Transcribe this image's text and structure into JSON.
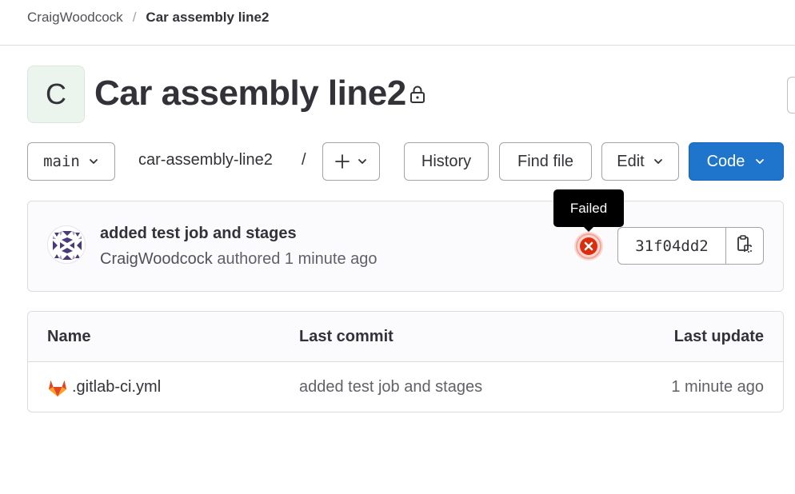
{
  "breadcrumb": {
    "owner": "CraigWoodcock",
    "separator": "/",
    "project": "Car assembly line2"
  },
  "project": {
    "avatar_letter": "C",
    "title": "Car assembly line2",
    "visibility_icon": "lock-icon"
  },
  "toolbar": {
    "branch": "main",
    "path": "car-assembly-line2",
    "path_separator": "/",
    "add_icon": "plus-icon",
    "history_label": "History",
    "find_file_label": "Find file",
    "edit_label": "Edit",
    "code_label": "Code"
  },
  "commit": {
    "title": "added test job and stages",
    "author": "CraigWoodcock",
    "authored_text": "authored 1 minute ago",
    "status_tooltip": "Failed",
    "status_icon": "failed-status-icon",
    "sha": "31f04dd2",
    "copy_icon": "copy-icon"
  },
  "files": {
    "columns": [
      "Name",
      "Last commit",
      "Last update"
    ],
    "rows": [
      {
        "name": ".gitlab-ci.yml",
        "icon": "gitlab-logo-icon",
        "last_commit": "added test job and stages",
        "last_update": "1 minute ago"
      }
    ]
  },
  "colors": {
    "primary_button": "#1f75cb",
    "failed_status": "#dd2b0e",
    "avatar_bg": "#ecf4ee"
  }
}
